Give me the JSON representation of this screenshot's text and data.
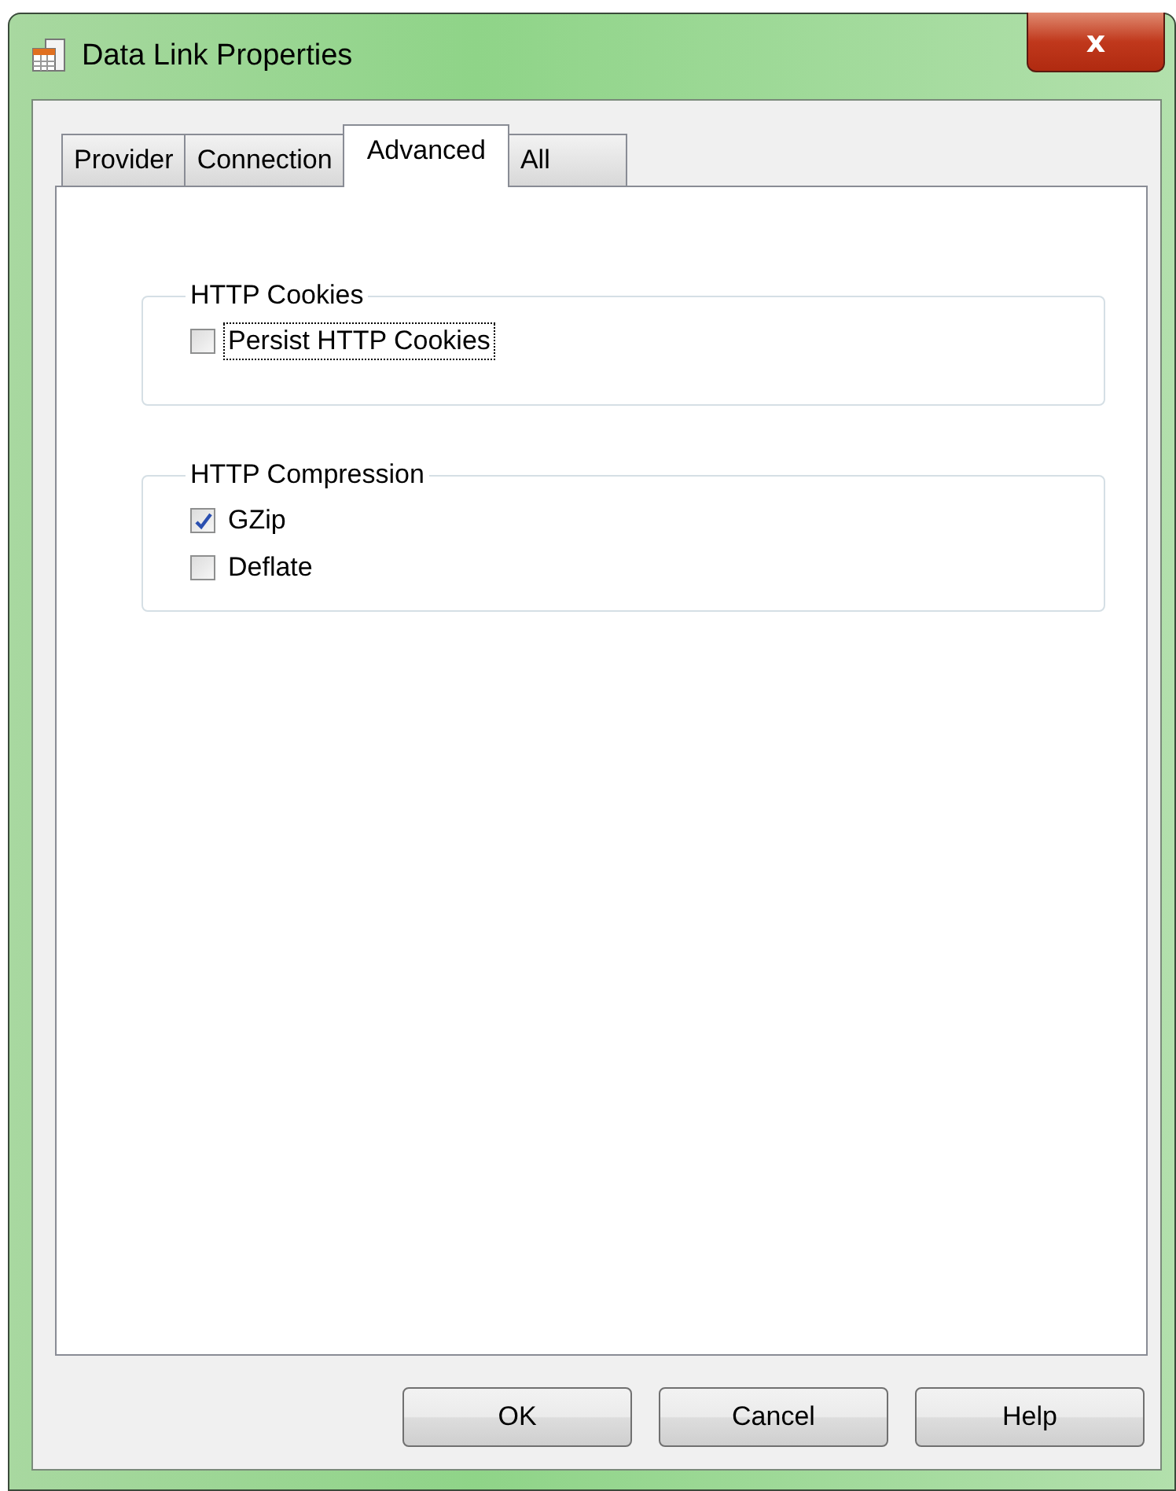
{
  "window": {
    "title": "Data Link Properties",
    "close": "x"
  },
  "tabs": [
    {
      "label": "Provider",
      "selected": false
    },
    {
      "label": "Connection",
      "selected": false
    },
    {
      "label": "Advanced",
      "selected": true
    },
    {
      "label": "All",
      "selected": false
    }
  ],
  "groups": [
    {
      "title": "HTTP Cookies",
      "options": [
        {
          "label": "Persist HTTP Cookies",
          "checked": false,
          "focused": true
        }
      ]
    },
    {
      "title": "HTTP Compression",
      "options": [
        {
          "label": "GZip",
          "checked": true,
          "focused": false
        },
        {
          "label": "Deflate",
          "checked": false,
          "focused": false
        }
      ]
    }
  ],
  "buttons": [
    "OK",
    "Cancel",
    "Help"
  ]
}
